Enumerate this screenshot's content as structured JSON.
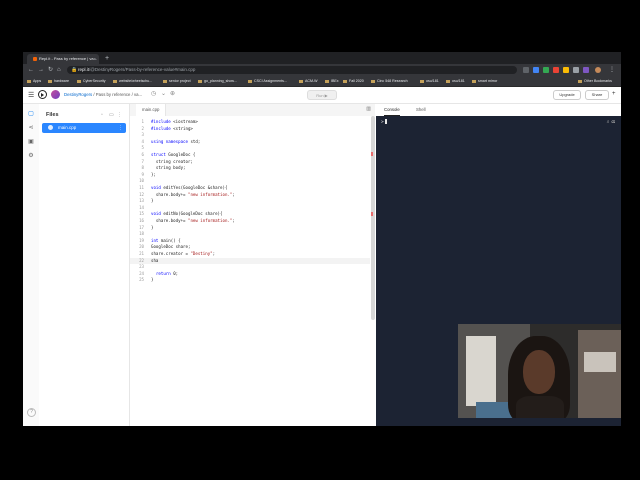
{
  "browser": {
    "tab_title": "Repl.it - Pass by reference | va...",
    "tab_close": "×",
    "new_tab": "+",
    "url_host": "repl.it",
    "url_path": "/@DestinyRogers/Pass-by-reference-value#main.cpp",
    "bookmarks": [
      "Apps",
      "hardware",
      "CyberSecurity",
      "website/wheelschu...",
      "senior project",
      "go_planning_show...",
      "CSCI Assignments...",
      "ACM-W",
      "IBEx",
      "Fall 2020",
      "Cinc 548 Research",
      "osu/181",
      "osu/181",
      "smart mirror"
    ],
    "other_bookmarks": "Other Bookmarks"
  },
  "header": {
    "user": "DestinyRogers",
    "separator": "/",
    "repl_name": "Pass by reference / va...",
    "run_label": "Run ▶",
    "upgrade_label": "Upgrade",
    "share_label": "Share",
    "plus_label": "+"
  },
  "files_panel": {
    "title": "Files",
    "items": [
      {
        "label": "main.cpp"
      }
    ],
    "more": "⋮"
  },
  "editor": {
    "tab_label": "main.cpp",
    "lines": [
      {
        "n": "1",
        "code": "#include <iostream>"
      },
      {
        "n": "2",
        "code": "#include <string>"
      },
      {
        "n": "3",
        "code": ""
      },
      {
        "n": "4",
        "code": "using namespace std;"
      },
      {
        "n": "5",
        "code": ""
      },
      {
        "n": "6",
        "code": "struct GoogleDoc {"
      },
      {
        "n": "7",
        "code": "  string creator;"
      },
      {
        "n": "8",
        "code": "  string body;"
      },
      {
        "n": "9",
        "code": "};"
      },
      {
        "n": "10",
        "code": ""
      },
      {
        "n": "11",
        "code": "void editYes(GoogleDoc &share){"
      },
      {
        "n": "12",
        "code": "  share.body+= \"new information.\";"
      },
      {
        "n": "13",
        "code": "}"
      },
      {
        "n": "14",
        "code": ""
      },
      {
        "n": "15",
        "code": "void editNo(GoogleDoc share){"
      },
      {
        "n": "16",
        "code": "  share.body+= \"new information.\";"
      },
      {
        "n": "17",
        "code": "}"
      },
      {
        "n": "18",
        "code": ""
      },
      {
        "n": "19",
        "code": "int main() {"
      },
      {
        "n": "20",
        "code": "GoogleDoc share;"
      },
      {
        "n": "21",
        "code": "share.creator = \"Destiny\";"
      },
      {
        "n": "22",
        "code": "sha"
      },
      {
        "n": "23",
        "code": ""
      },
      {
        "n": "24",
        "code": "  return 0;"
      },
      {
        "n": "25",
        "code": "}"
      }
    ]
  },
  "console": {
    "tab_console": "Console",
    "tab_shell": "Shell",
    "prompt": ">"
  },
  "colors": {
    "accent": "#0079f2",
    "file_selected": "#2a86ff",
    "console_bg": "#1c2333"
  }
}
